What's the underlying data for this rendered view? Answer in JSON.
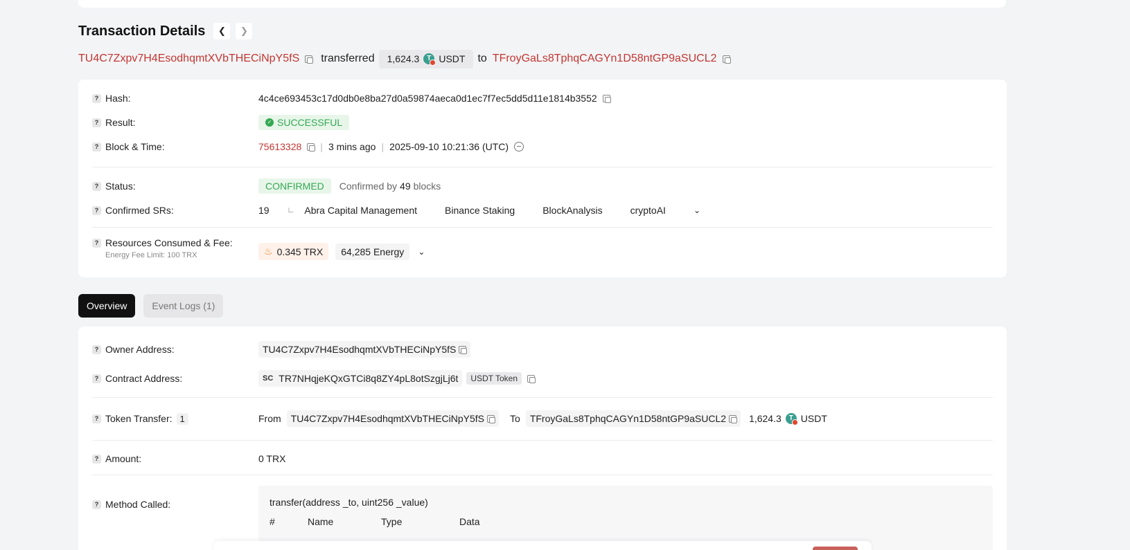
{
  "header": {
    "title": "Transaction Details",
    "prev_icon": "chevron-left-icon",
    "next_icon": "chevron-right-icon"
  },
  "summary": {
    "from": "TU4C7Zxpv7H4EsodhqmtXVbTHECiNpY5fS",
    "verb": "transferred",
    "amount": "1,624.3",
    "token": "USDT",
    "to_word": "to",
    "to": "TFroyGaLs8TphqCAGYn1D58ntGP9aSUCL2"
  },
  "details": {
    "hash_label": "Hash:",
    "hash": "4c4ce693453c17d0db0e8ba27d0a59874aeca0d1ec7f7ec5dd5d11e1814b3552",
    "result_label": "Result:",
    "result": "SUCCESSFUL",
    "block_label": "Block & Time:",
    "block": "75613328",
    "ago": "3 mins ago",
    "time": "2025-09-10 10:21:36 (UTC)",
    "status_label": "Status:",
    "status": "CONFIRMED",
    "confirmed_by_prefix": "Confirmed by",
    "confirmed_blocks": "49",
    "confirmed_by_suffix": "blocks",
    "srs_label": "Confirmed SRs:",
    "srs_count": "19",
    "srs": [
      "Abra Capital Management",
      "Binance Staking",
      "BlockAnalysis",
      "cryptoAI"
    ],
    "fee_label": "Resources Consumed & Fee:",
    "fee_sub": "Energy Fee Limit: 100 TRX",
    "fee_trx": "0.345 TRX",
    "fee_energy": "64,285 Energy"
  },
  "tabs": [
    {
      "label": "Overview",
      "active": true
    },
    {
      "label": "Event Logs (1)",
      "active": false
    }
  ],
  "overview": {
    "owner_label": "Owner Address:",
    "owner": "TU4C7Zxpv7H4EsodhqmtXVbTHECiNpY5fS",
    "contract_label": "Contract Address:",
    "contract_tag": "SC",
    "contract": "TR7NHqjeKQxGTCi8q8ZY4pL8otSzgjLj6t",
    "contract_token": "USDT Token",
    "transfer_label": "Token Transfer:",
    "transfer_count": "1",
    "from_word": "From",
    "transfer_from": "TU4C7Zxpv7H4EsodhqmtXVbTHECiNpY5fS",
    "to_word": "To",
    "transfer_to": "TFroyGaLs8TphqCAGYn1D58ntGP9aSUCL2",
    "transfer_amount": "1,624.3",
    "transfer_token": "USDT",
    "amount_label": "Amount:",
    "amount": "0 TRX",
    "method_label": "Method Called:",
    "method_sig": "transfer(address _to, uint256 _value)",
    "method_cols": [
      "#",
      "Name",
      "Type",
      "Data"
    ]
  },
  "colors": {
    "accent_red": "#c23631",
    "success_green": "#34a852",
    "tab_active": "#111111"
  }
}
